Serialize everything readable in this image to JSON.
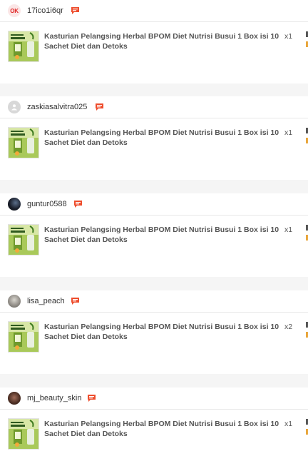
{
  "orders": [
    {
      "username": "17ico1i6qr",
      "avatar_type": "ok-logo",
      "avatar_text": "OK",
      "product_name": "Kasturian Pelangsing Herbal BPOM Diet Nutrisi Busui 1 Box isi 10 Sachet Diet dan Detoks",
      "quantity": "x1"
    },
    {
      "username": "zaskiasalvitra025",
      "avatar_type": "default-avatar",
      "product_name": "Kasturian Pelangsing Herbal BPOM Diet Nutrisi Busui 1 Box isi 10 Sachet Diet dan Detoks",
      "quantity": "x1"
    },
    {
      "username": "guntur0588",
      "avatar_type": "photo",
      "product_name": "Kasturian Pelangsing Herbal BPOM Diet Nutrisi Busui 1 Box isi 10 Sachet Diet dan Detoks",
      "quantity": "x1"
    },
    {
      "username": "lisa_peach",
      "avatar_type": "photo",
      "product_name": "Kasturian Pelangsing Herbal BPOM Diet Nutrisi Busui 1 Box isi 10 Sachet Diet dan Detoks",
      "quantity": "x2"
    },
    {
      "username": "mj_beauty_skin",
      "avatar_type": "photo",
      "product_name": "Kasturian Pelangsing Herbal BPOM Diet Nutrisi Busui 1 Box isi 10 Sachet Diet dan Detoks",
      "quantity": "x1"
    }
  ],
  "colors": {
    "chat_icon": "#ee4d2d",
    "text_primary": "#333333",
    "background": "#f5f5f5"
  },
  "icons": {
    "chat": "chat-icon",
    "default_avatar": "person-icon"
  }
}
